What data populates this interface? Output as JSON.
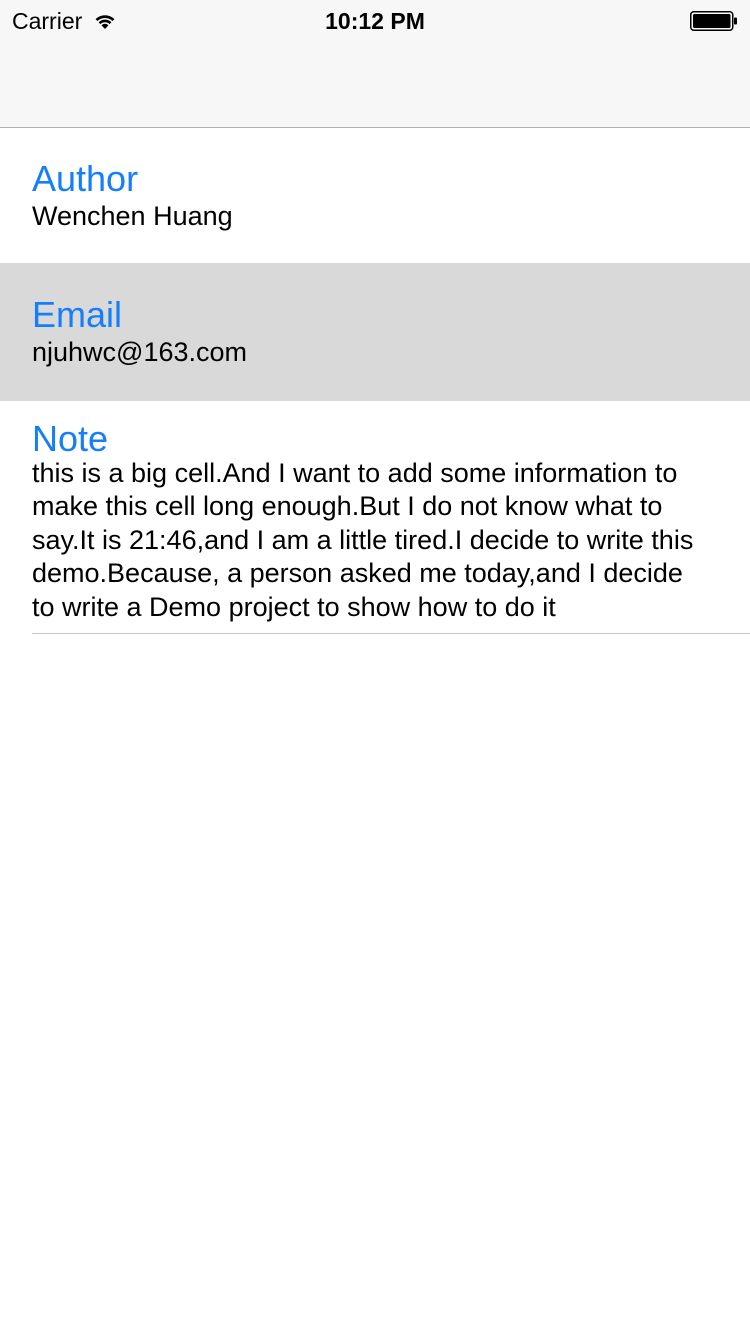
{
  "status_bar": {
    "carrier": "Carrier",
    "time": "10:12 PM",
    "icons": [
      "wifi-icon",
      "battery-icon"
    ]
  },
  "colors": {
    "accent": "#147EFB",
    "selected_row": "#D9D9D9",
    "nav_bar": "#F7F7F7"
  },
  "rows": [
    {
      "title": "Author",
      "value": "Wenchen Huang",
      "selected": false
    },
    {
      "title": "Email",
      "value": "njuhwc@163.com",
      "selected": true
    },
    {
      "title": "Note",
      "value": "this is a big cell.And I want to add some information to make this cell long enough.But I do not know what to say.It is 21:46,and I am a little tired.I decide to write this demo.Because, a person asked me today,and I decide to write a Demo project to show how to do it",
      "selected": false
    }
  ]
}
